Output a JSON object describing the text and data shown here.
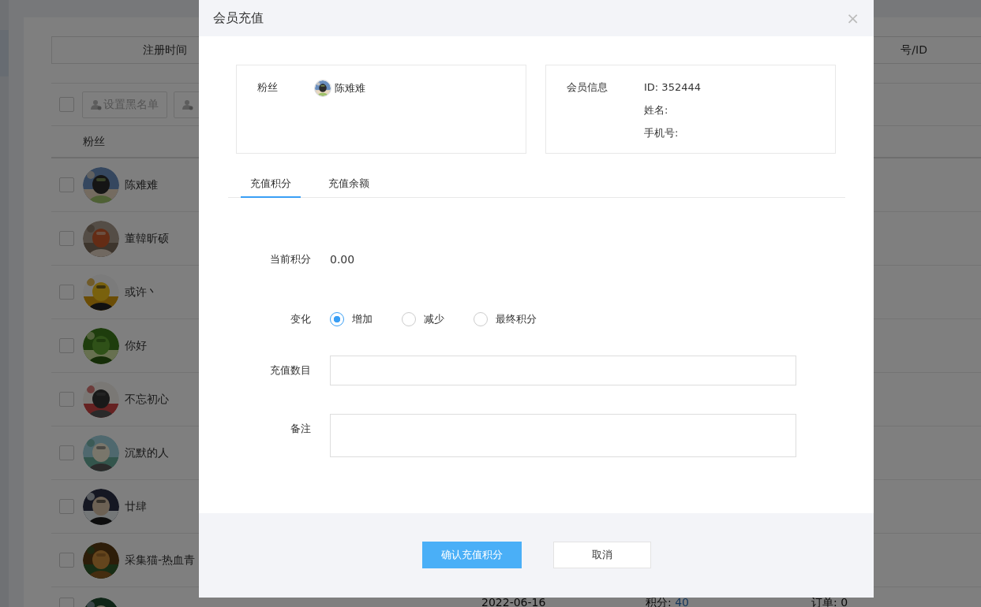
{
  "background": {
    "filter_bar": {
      "column_1": "注册时间",
      "column_2": "号/ID"
    },
    "toolbar": {
      "select_all": {
        "checked": false
      },
      "buttons": [
        {
          "kind": "labeled",
          "label": "设置黑名单"
        },
        {
          "kind": "cut"
        }
      ]
    },
    "table": {
      "columns": [
        "粉丝"
      ],
      "rows": [
        {
          "name": "陈难难",
          "checked": false
        },
        {
          "name": "董韓昕硕",
          "checked": false
        },
        {
          "name": "或许丶",
          "checked": false
        },
        {
          "name": "你好",
          "checked": false
        },
        {
          "name": "不忘初心",
          "checked": false
        },
        {
          "name": "沉默的人",
          "checked": false
        },
        {
          "name": "廿肆",
          "checked": false
        },
        {
          "name": "采集猫-热血青",
          "checked": false
        },
        {
          "checked": false,
          "date": "2022-06-16",
          "points_label": "积分:",
          "points_value": "40",
          "orders": "订单: 0"
        }
      ]
    }
  },
  "dialog": {
    "title": "会员充值",
    "close": "×",
    "fan": {
      "label": "粉丝",
      "name": "陈难难"
    },
    "member": {
      "label": "会员信息",
      "lines": [
        "ID: 352444",
        "姓名:",
        "手机号:"
      ]
    },
    "tabs": [
      {
        "label": "充值积分",
        "selected": true
      },
      {
        "label": "充值余额",
        "selected": false
      }
    ],
    "form": {
      "current_label": "当前积分",
      "current_value": "0.00",
      "change_label": "变化",
      "change_options": [
        {
          "label": "增加",
          "selected": true
        },
        {
          "label": "减少",
          "selected": false
        },
        {
          "label": "最终积分",
          "selected": false
        }
      ],
      "amount_label": "充值数目",
      "note_label": "备注"
    },
    "buttons": [
      {
        "label": "确认充值积分",
        "kind": "primary"
      },
      {
        "label": "取消",
        "kind": "default"
      }
    ]
  }
}
